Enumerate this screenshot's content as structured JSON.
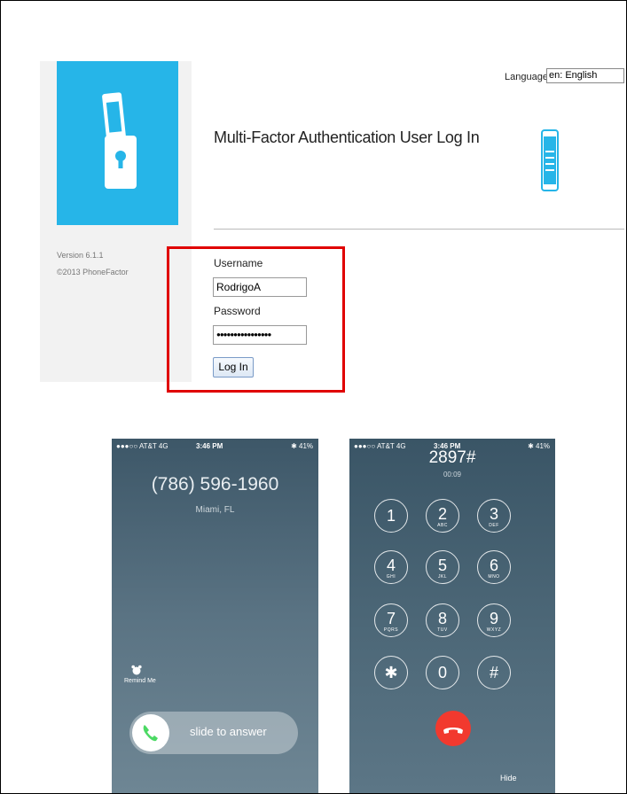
{
  "login": {
    "language_label": "Language:",
    "language_value": "en: English",
    "title": "Multi-Factor Authentication User Log In",
    "version": "Version 6.1.1",
    "copyright": "©2013 PhoneFactor",
    "username_label": "Username",
    "username_value": "RodrigoA",
    "password_label": "Password",
    "password_value": "●●●●●●●●●●●●●●●●",
    "login_button": "Log In",
    "colors": {
      "brand": "#26b5e8",
      "highlight": "#e00000"
    },
    "icons": [
      "padlock-phone-icon",
      "mobile-transfer-icon"
    ]
  },
  "incoming_call": {
    "carrier": "●●●○○ AT&T  4G",
    "time": "3:46 PM",
    "battery": "✱ 41%",
    "caller_number": "(786) 596-1960",
    "caller_location": "Miami, FL",
    "remind_label": "Remind Me",
    "slide_text": "slide to answer"
  },
  "keypad_screen": {
    "carrier": "●●●○○ AT&T  4G",
    "time": "3:46 PM",
    "battery": "✱ 41%",
    "dialed": "2897#",
    "timer": "00:09",
    "keys": [
      {
        "digit": "1",
        "letters": ""
      },
      {
        "digit": "2",
        "letters": "ABC"
      },
      {
        "digit": "3",
        "letters": "DEF"
      },
      {
        "digit": "4",
        "letters": "GHI"
      },
      {
        "digit": "5",
        "letters": "JKL"
      },
      {
        "digit": "6",
        "letters": "MNO"
      },
      {
        "digit": "7",
        "letters": "PQRS"
      },
      {
        "digit": "8",
        "letters": "TUV"
      },
      {
        "digit": "9",
        "letters": "WXYZ"
      },
      {
        "digit": "✱",
        "letters": ""
      },
      {
        "digit": "0",
        "letters": ""
      },
      {
        "digit": "#",
        "letters": ""
      }
    ],
    "hide_label": "Hide"
  }
}
